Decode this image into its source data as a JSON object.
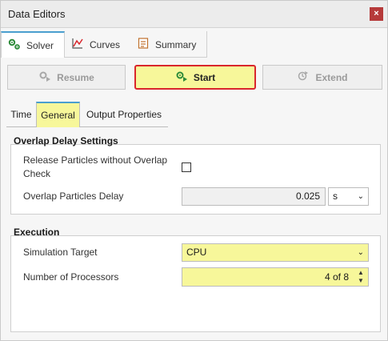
{
  "window": {
    "title": "Data Editors",
    "close_label": "×"
  },
  "main_tabs": [
    {
      "label": "Solver",
      "icon": "gears-icon",
      "active": true
    },
    {
      "label": "Curves",
      "icon": "chart-line-icon",
      "active": false
    },
    {
      "label": "Summary",
      "icon": "document-icon",
      "active": false
    }
  ],
  "toolbar": {
    "resume_label": "Resume",
    "start_label": "Start",
    "extend_label": "Extend"
  },
  "sub_tabs": [
    {
      "label": "Time",
      "active": false
    },
    {
      "label": "General",
      "active": true
    },
    {
      "label": "Output Properties",
      "active": false
    }
  ],
  "overlap": {
    "title": "Overlap Delay Settings",
    "release_label": "Release Particles without Overlap Check",
    "release_checked": false,
    "delay_label": "Overlap Particles Delay",
    "delay_value": "0.025",
    "delay_unit": "s"
  },
  "execution": {
    "title": "Execution",
    "target_label": "Simulation Target",
    "target_value": "CPU",
    "processors_label": "Number of Processors",
    "processors_value": "4 of 8"
  },
  "colors": {
    "highlight": "#f7f79a",
    "start_border": "#d9262c",
    "close_bg": "#b63a3a",
    "tab_accent": "#4a9fcf"
  }
}
